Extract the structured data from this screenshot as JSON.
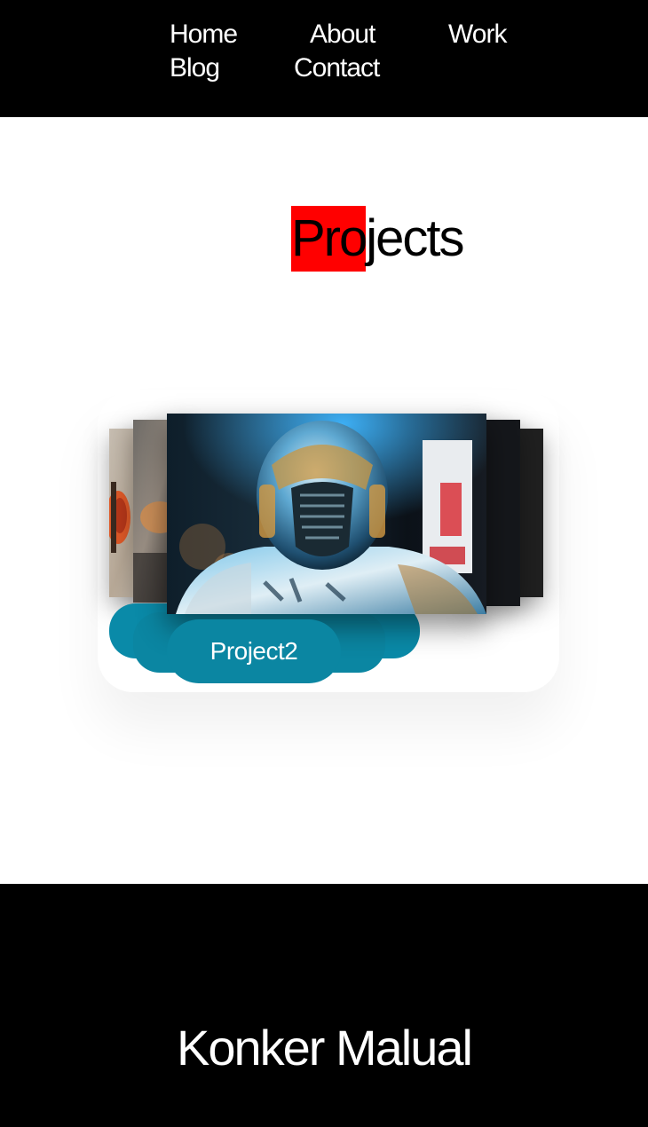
{
  "nav": {
    "items": [
      {
        "label": "Home"
      },
      {
        "label": "About"
      },
      {
        "label": "Work"
      },
      {
        "label": "Blog"
      },
      {
        "label": "Contact"
      }
    ]
  },
  "projects": {
    "title_highlight": "Pro",
    "title_rest": "jects",
    "active_label": "Project2",
    "highlight_color": "#ff0000",
    "pill_color": "#0a8aa8"
  },
  "footer": {
    "name": "Konker Malual"
  }
}
